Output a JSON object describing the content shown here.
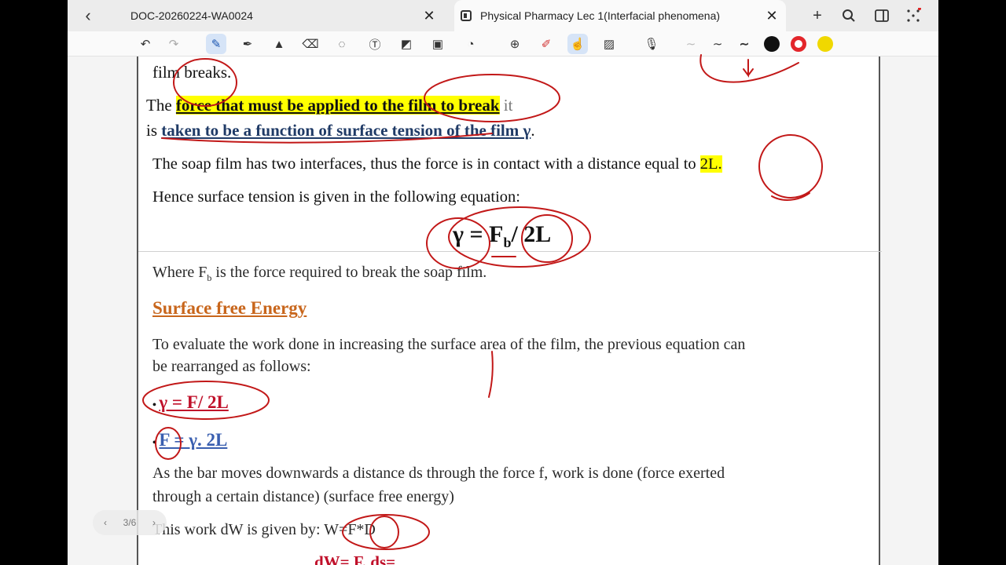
{
  "tabs": [
    {
      "label": "DOC-20260224-WA0024"
    },
    {
      "label": "Physical Pharmacy Lec 1(Interfacial phenomena)"
    }
  ],
  "toolbar": {
    "tools": [
      "undo-icon",
      "redo-icon",
      "pen-icon",
      "fountain-pen-icon",
      "highlighter-icon",
      "eraser-icon",
      "lasso-icon",
      "text-icon",
      "shape-icon",
      "image-icon",
      "sticker-icon",
      "zoom-in-icon",
      "pencil-erase-icon",
      "touch-draw-icon",
      "texture-icon",
      "mic-icon"
    ],
    "colors": [
      "#111111",
      "#e3262b",
      "#f0d800"
    ]
  },
  "document": {
    "line1": "film breaks.",
    "line2_prefix": "The ",
    "line2_hl": "force that must be applied to the film to break",
    "line2_suffix": " it",
    "line3_prefix": "is ",
    "line3_ul": "taken to be a function of surface tension of the film γ",
    "line3_suffix": ".",
    "line4_prefix": "The soap film has two interfaces, thus the force is in contact with a distance equal to ",
    "line4_hl": "2L.",
    "line5": "Hence surface tension is given in the following equation:",
    "eq1_gamma": "γ = F",
    "eq1_sub": "b",
    "eq1_rest": "/ 2L",
    "line6_a": "Where F",
    "line6_sub": "b",
    "line6_b": " is the force required to break the soap film.",
    "heading": "Surface free Energy",
    "para1_l1": "To evaluate the work done in increasing the surface area of the film, the previous equation can",
    "para1_l2": "be rearranged as follows:",
    "bullet1": "γ = F/ 2L",
    "bullet2": "F = γ. 2L",
    "para2_l1": "As the bar moves downwards a distance ds through the force f, work is done (force exerted",
    "para2_l2": "through a certain distance) (surface free energy)",
    "line7_prefix": "This work dW is given by: ",
    "line7_eq": "W=F*D",
    "line8": "dW= F. ds="
  },
  "pager": {
    "text": "3/6"
  }
}
